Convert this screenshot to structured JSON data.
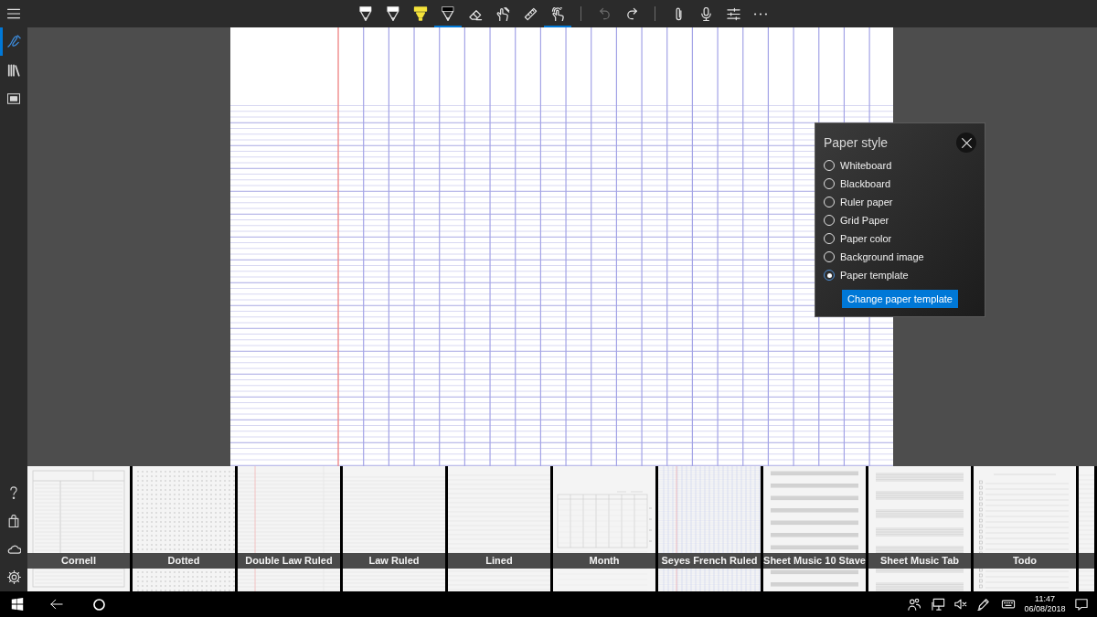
{
  "toolbar": {
    "groups": [
      [
        {
          "kind": "pen",
          "color": "#ffffff",
          "selected": false
        },
        {
          "kind": "pen",
          "color": "#ffffff",
          "selected": false
        },
        {
          "kind": "highlighter",
          "color": "#f5e33b",
          "selected": false
        },
        {
          "kind": "pen",
          "color": "#000000",
          "selected": true
        },
        {
          "kind": "eraser",
          "selected": false
        },
        {
          "kind": "touchwriting",
          "selected": false
        },
        {
          "kind": "ruler",
          "selected": false
        },
        {
          "kind": "touch",
          "selected": true
        }
      ],
      [
        {
          "kind": "undo",
          "disabled": true
        },
        {
          "kind": "redo",
          "disabled": false
        }
      ],
      [
        {
          "kind": "attach"
        },
        {
          "kind": "microphone"
        },
        {
          "kind": "settings"
        },
        {
          "kind": "more"
        }
      ]
    ]
  },
  "sidebar": {
    "nav": [
      {
        "kind": "ink",
        "selected": true
      },
      {
        "kind": "library",
        "selected": false
      },
      {
        "kind": "slideshow",
        "selected": false
      }
    ],
    "bottom": [
      {
        "kind": "help"
      },
      {
        "kind": "store"
      },
      {
        "kind": "cloud"
      },
      {
        "kind": "settings"
      }
    ]
  },
  "canvas": {
    "paper": {
      "kind": "seyes"
    }
  },
  "paper_style_panel": {
    "title": "Paper style",
    "options": [
      {
        "label": "Whiteboard",
        "selected": false
      },
      {
        "label": "Blackboard",
        "selected": false
      },
      {
        "label": "Ruler paper",
        "selected": false
      },
      {
        "label": "Grid Paper",
        "selected": false
      },
      {
        "label": "Paper color",
        "selected": false
      },
      {
        "label": "Background image",
        "selected": false
      },
      {
        "label": "Paper template",
        "selected": true
      }
    ],
    "button": "Change paper template"
  },
  "templates": [
    {
      "kind": "cornell",
      "label": "Cornell"
    },
    {
      "kind": "dotted",
      "label": "Dotted"
    },
    {
      "kind": "doublelaw",
      "label": "Double Law Ruled"
    },
    {
      "kind": "law",
      "label": "Law Ruled"
    },
    {
      "kind": "lined",
      "label": "Lined"
    },
    {
      "kind": "month",
      "label": "Month"
    },
    {
      "kind": "seyes",
      "label": "Seyes French Ruled"
    },
    {
      "kind": "staff",
      "label": "Sheet Music 10 Stave"
    },
    {
      "kind": "tab",
      "label": "Sheet Music Tab"
    },
    {
      "kind": "todo",
      "label": "Todo"
    },
    {
      "kind": "lined"
    }
  ],
  "taskbar": {
    "tray": [
      {
        "kind": "people"
      },
      {
        "kind": "network"
      },
      {
        "kind": "volume",
        "muted": true
      },
      {
        "kind": "pen"
      },
      {
        "kind": "keyboard"
      }
    ],
    "time": "11:47",
    "date": "06/08/2018"
  }
}
